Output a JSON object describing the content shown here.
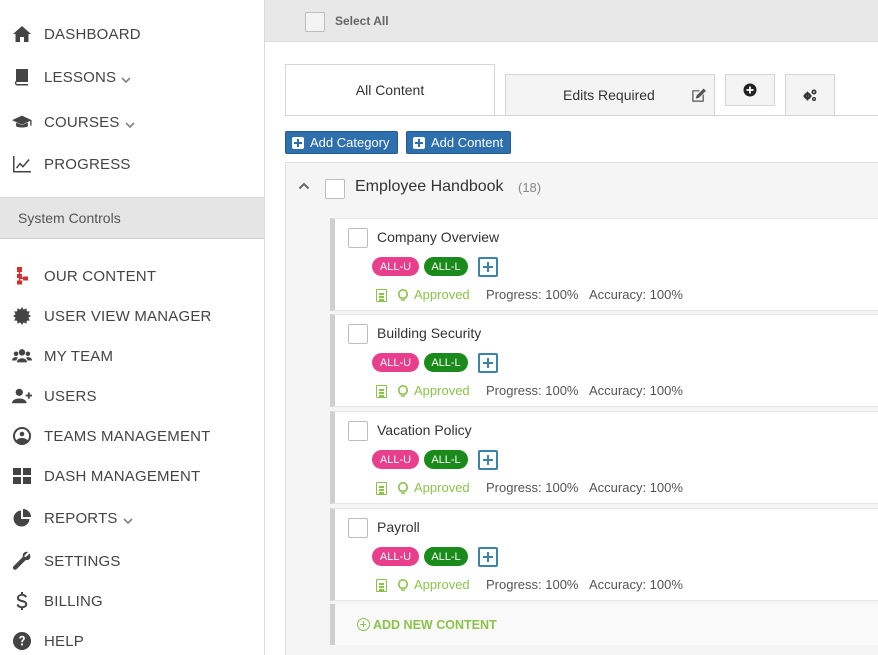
{
  "sidebar": {
    "items": [
      {
        "label": "DASHBOARD",
        "icon": "home-icon"
      },
      {
        "label": "LESSONS",
        "icon": "book-icon",
        "dropdown": true
      },
      {
        "label": "COURSES",
        "icon": "graduation-cap-icon",
        "dropdown": true
      },
      {
        "label": "PROGRESS",
        "icon": "line-chart-icon"
      }
    ],
    "section_title": "System Controls",
    "controls": [
      {
        "label": "OUR CONTENT",
        "icon": "sitemap-icon"
      },
      {
        "label": "USER VIEW MANAGER",
        "icon": "gear-badge-icon"
      },
      {
        "label": "MY TEAM",
        "icon": "users-icon"
      },
      {
        "label": "USERS",
        "icon": "user-plus-icon"
      },
      {
        "label": "TEAMS MANAGEMENT",
        "icon": "user-circle-icon"
      },
      {
        "label": "DASH MANAGEMENT",
        "icon": "grid-icon"
      },
      {
        "label": "REPORTS",
        "icon": "pie-chart-icon",
        "dropdown": true
      },
      {
        "label": "SETTINGS",
        "icon": "wrench-icon"
      },
      {
        "label": "BILLING",
        "icon": "dollar-icon"
      },
      {
        "label": "HELP",
        "icon": "question-circle-icon"
      }
    ]
  },
  "main": {
    "select_all": "Select All",
    "tabs": {
      "all_content": "All Content",
      "edits_required": "Edits Required"
    },
    "buttons": {
      "add_category": "Add Category",
      "add_content": "Add Content"
    },
    "category": {
      "title": "Employee Handbook",
      "count": "(18)"
    },
    "items": [
      {
        "title": "Company Overview",
        "badge_u": "ALL-U",
        "badge_l": "ALL-L",
        "status": "Approved",
        "progress": "Progress: 100%",
        "accuracy": "Accuracy: 100%"
      },
      {
        "title": "Building Security",
        "badge_u": "ALL-U",
        "badge_l": "ALL-L",
        "status": "Approved",
        "progress": "Progress: 100%",
        "accuracy": "Accuracy: 100%"
      },
      {
        "title": "Vacation Policy",
        "badge_u": "ALL-U",
        "badge_l": "ALL-L",
        "status": "Approved",
        "progress": "Progress: 100%",
        "accuracy": "Accuracy: 100%"
      },
      {
        "title": "Payroll",
        "badge_u": "ALL-U",
        "badge_l": "ALL-L",
        "status": "Approved",
        "progress": "Progress: 100%",
        "accuracy": "Accuracy: 100%"
      }
    ],
    "add_new_content": "ADD NEW CONTENT"
  },
  "colors": {
    "primary_button": "#2e6fae",
    "badge_u": "#e83e8c",
    "badge_l": "#1a8a1a",
    "approved": "#8bc34a"
  }
}
